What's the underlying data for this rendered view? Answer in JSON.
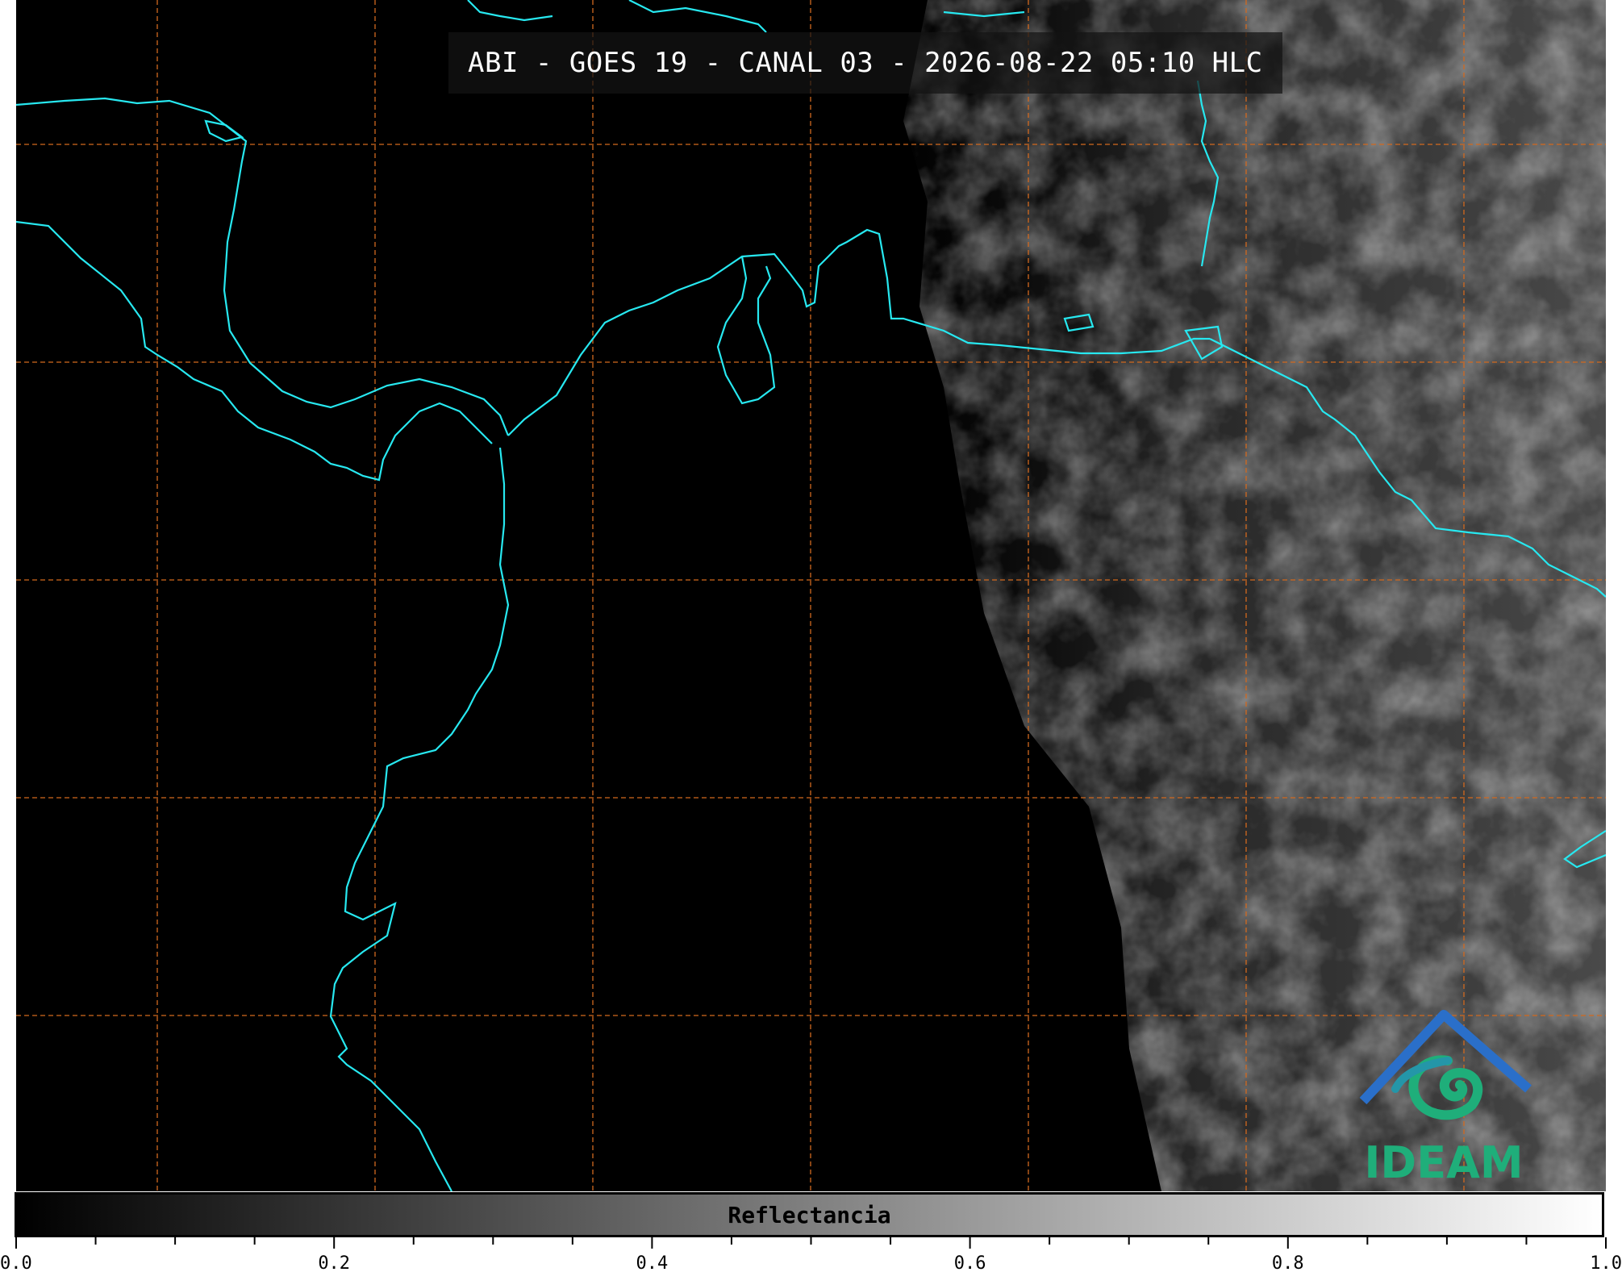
{
  "title": "ABI - GOES 19 - CANAL 03 - 2026-08-22 05:10 HLC",
  "logo": {
    "text": "IDEAM",
    "colors": {
      "roof": "#2a6fc9",
      "swirl": "#1fae7a"
    }
  },
  "colorbar": {
    "label": "Reflectancia",
    "range": [
      0.0,
      1.0
    ],
    "tick_labels": [
      "0.0",
      "0.2",
      "0.4",
      "0.6",
      "0.8",
      "1.0"
    ],
    "minor_step": 0.05,
    "colormap": [
      "#000000",
      "#ffffff"
    ]
  },
  "map": {
    "background": "#000000",
    "coastline_color": "#27e8f0",
    "gridline_color": "#d2691e",
    "gridline_style": "dashed"
  }
}
